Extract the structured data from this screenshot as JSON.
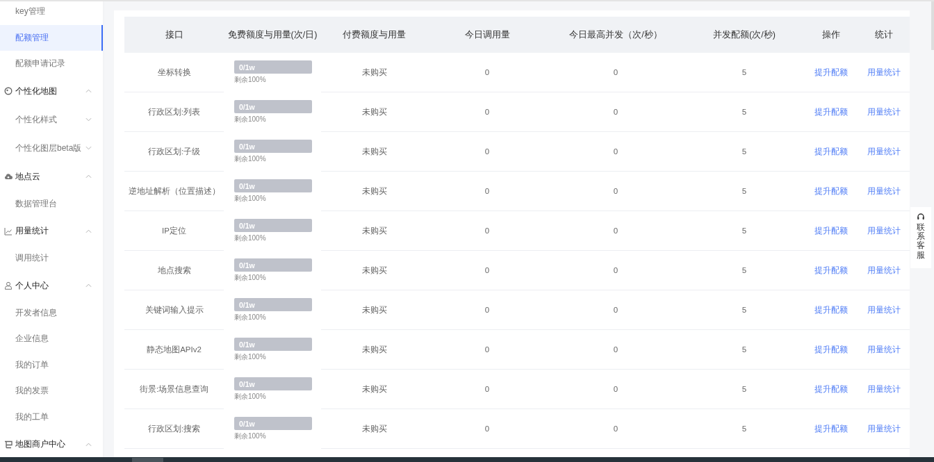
{
  "sidebar": {
    "items": [
      {
        "kind": "item",
        "label": "key管理",
        "selected": false
      },
      {
        "kind": "item",
        "label": "配额管理",
        "selected": true
      },
      {
        "kind": "item",
        "label": "配额申请记录",
        "selected": false
      },
      {
        "kind": "group",
        "label": "个性化地图",
        "expanded": true
      },
      {
        "kind": "sub",
        "label": "个性化样式",
        "expanded": false
      },
      {
        "kind": "sub",
        "label": "个性化图层beta版",
        "expanded": false
      },
      {
        "kind": "group",
        "label": "地点云",
        "expanded": true
      },
      {
        "kind": "item",
        "label": "数据管理台",
        "selected": false
      },
      {
        "kind": "group",
        "label": "用量统计",
        "expanded": true
      },
      {
        "kind": "item",
        "label": "调用统计",
        "selected": false
      },
      {
        "kind": "group",
        "label": "个人中心",
        "expanded": true
      },
      {
        "kind": "item",
        "label": "开发者信息",
        "selected": false
      },
      {
        "kind": "item",
        "label": "企业信息",
        "selected": false
      },
      {
        "kind": "item",
        "label": "我的订单",
        "selected": false
      },
      {
        "kind": "item",
        "label": "我的发票",
        "selected": false
      },
      {
        "kind": "item",
        "label": "我的工单",
        "selected": false
      },
      {
        "kind": "group",
        "label": "地图商户中心",
        "expanded": true
      }
    ]
  },
  "table": {
    "columns": [
      "接口",
      "免费额度与用量(次/日)",
      "付费额度与用量",
      "今日调用量",
      "今日最高并发（次/秒）",
      "并发配额(次/秒)",
      "操作",
      "统计"
    ],
    "rows": [
      {
        "api": "坐标转换",
        "quota": "0/1w",
        "level": 0,
        "remaining": "剩余100%",
        "paid": "未购买",
        "calls": "0",
        "peak": "0",
        "limit": "5",
        "action": "提升配额",
        "stats": "用量统计"
      },
      {
        "api": "行政区划:列表",
        "quota": "0/1w",
        "level": 0,
        "remaining": "剩余100%",
        "paid": "未购买",
        "calls": "0",
        "peak": "0",
        "limit": "5",
        "action": "提升配额",
        "stats": "用量统计"
      },
      {
        "api": "行政区划:子级",
        "quota": "0/1w",
        "level": 0,
        "remaining": "剩余100%",
        "paid": "未购买",
        "calls": "0",
        "peak": "0",
        "limit": "5",
        "action": "提升配额",
        "stats": "用量统计"
      },
      {
        "api": "逆地址解析（位置描述）",
        "quota": "0/1w",
        "level": 0,
        "remaining": "剩余100%",
        "paid": "未购买",
        "calls": "0",
        "peak": "0",
        "limit": "5",
        "action": "提升配额",
        "stats": "用量统计"
      },
      {
        "api": "IP定位",
        "quota": "0/1w",
        "level": 0,
        "remaining": "剩余100%",
        "paid": "未购买",
        "calls": "0",
        "peak": "0",
        "limit": "5",
        "action": "提升配额",
        "stats": "用量统计"
      },
      {
        "api": "地点搜索",
        "quota": "0/1w",
        "level": 0,
        "remaining": "剩余100%",
        "paid": "未购买",
        "calls": "0",
        "peak": "0",
        "limit": "5",
        "action": "提升配额",
        "stats": "用量统计"
      },
      {
        "api": "关键词输入提示",
        "quota": "0/1w",
        "level": 0,
        "remaining": "剩余100%",
        "paid": "未购买",
        "calls": "0",
        "peak": "0",
        "limit": "5",
        "action": "提升配额",
        "stats": "用量统计"
      },
      {
        "api": "静态地图APIv2",
        "quota": "0/1w",
        "level": 0,
        "remaining": "剩余100%",
        "paid": "未购买",
        "calls": "0",
        "peak": "0",
        "limit": "5",
        "action": "提升配额",
        "stats": "用量统计"
      },
      {
        "api": "街景:场景信息查询",
        "quota": "0/1w",
        "level": 0,
        "remaining": "剩余100%",
        "paid": "未购买",
        "calls": "0",
        "peak": "0",
        "limit": "5",
        "action": "提升配额",
        "stats": "用量统计"
      },
      {
        "api": "行政区划:搜索",
        "quota": "0/1w",
        "level": 0,
        "remaining": "剩余100%",
        "paid": "未购买",
        "calls": "0",
        "peak": "0",
        "limit": "5",
        "action": "提升配额",
        "stats": "用量统计"
      }
    ]
  },
  "support_tab": {
    "label": "联系客服"
  }
}
